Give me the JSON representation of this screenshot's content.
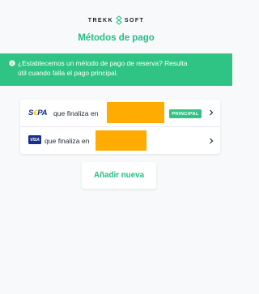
{
  "brand": {
    "left": "TREKK",
    "right": "SOFT"
  },
  "page_title": "Métodos de pago",
  "banner": {
    "line1": "¿Establecemos un método de pago de reserva? Resulta",
    "line2": "útil cuando falla el pago principal."
  },
  "payment_methods": [
    {
      "logo": "SEPA",
      "text": "que finaliza en",
      "badge": "PRINCIPAL"
    },
    {
      "logo": "VISA",
      "text": "que finaliza en"
    }
  ],
  "add_button": "Añadir nueva",
  "colors": {
    "accent": "#2fc483",
    "title_green": "#22bf82",
    "redaction": "#ffab00"
  }
}
